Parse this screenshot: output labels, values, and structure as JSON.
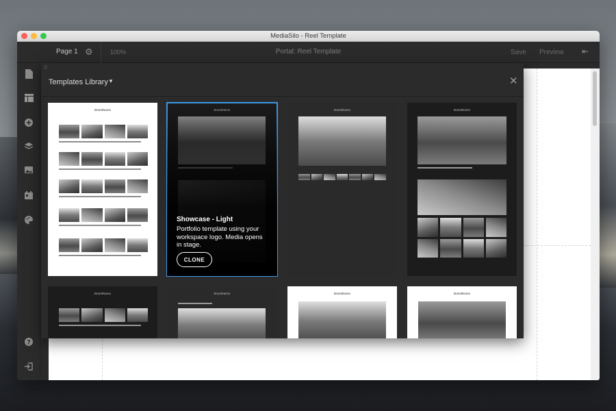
{
  "window": {
    "title": "MediaSilo - Reel Template"
  },
  "topbar": {
    "page_label": "Page 1",
    "zoom": "100%",
    "portal_title": "Portal: Reel Template",
    "save_label": "Save",
    "preview_label": "Preview"
  },
  "library": {
    "title": "Templates Library",
    "cards": [
      {
        "brand": "BrandName"
      },
      {
        "brand": "BrandName",
        "hover_title": "Showcase - Light",
        "hover_desc": "Portfolio template using your workspace logo. Media opens in stage.",
        "clone_label": "CLONE"
      },
      {
        "brand": "BrandName"
      },
      {
        "brand": "BrandName"
      },
      {
        "brand": "BrandName"
      },
      {
        "brand": "BrandName"
      },
      {
        "brand": "BrandName"
      },
      {
        "brand": "BrandName"
      }
    ]
  },
  "icons": {
    "leftbar": [
      "page-icon",
      "layout-icon",
      "add-icon",
      "layers-icon",
      "image-icon",
      "calendar-icon",
      "palette-icon",
      "help-icon",
      "logout-icon"
    ],
    "topbar": [
      "gear-icon",
      "exit-icon"
    ],
    "library": [
      "chevron-down-icon",
      "close-icon"
    ]
  },
  "colors": {
    "selection": "#3d9be9",
    "panel": "#2b2b2b"
  }
}
